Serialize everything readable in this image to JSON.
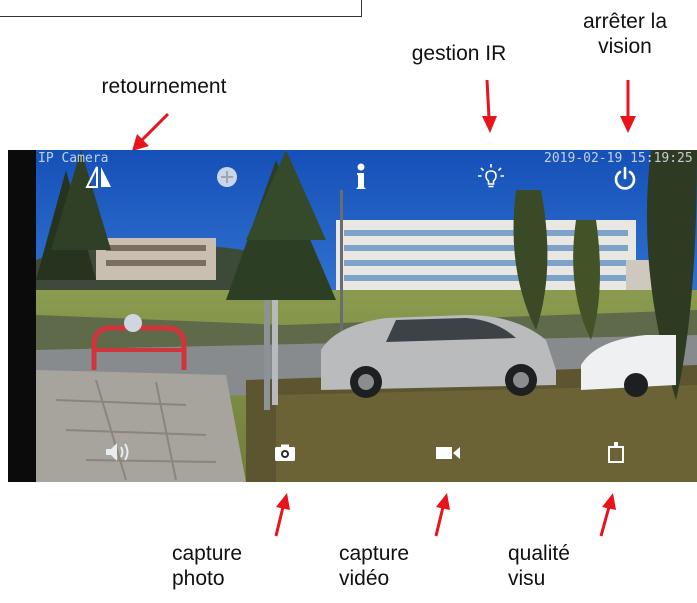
{
  "annotations": {
    "retournement": "retournement",
    "gestion_ir": "gestion IR",
    "arreter_line1": "arrêter la",
    "arreter_line2": "vision",
    "capture_photo_line1": "capture",
    "capture_photo_line2": "photo",
    "capture_video_line1": "capture",
    "capture_video_line2": "vidéo",
    "qualite_line1": "qualité",
    "qualite_line2": "visu"
  },
  "viewer": {
    "osd_camera_name": "IP Camera",
    "osd_timestamp": "2019-02-19 15:19:25"
  },
  "controls": {
    "top": [
      "flip-icon",
      "ptz-plus-icon",
      "info-icon",
      "ir-light-icon",
      "power-icon"
    ],
    "bottom": [
      "speaker-icon",
      "camera-icon",
      "video-camera-icon",
      "quality-icon"
    ]
  },
  "colors": {
    "arrow": "#e8141b",
    "icon": "#ffffff",
    "viewer_frame": "#0b0b0b"
  }
}
